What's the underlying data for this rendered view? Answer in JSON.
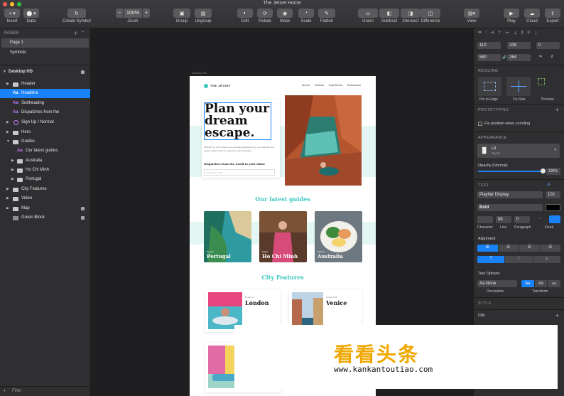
{
  "window": {
    "title": "The Jetset Home"
  },
  "toolbar": {
    "insert": "Insert",
    "data": "Data",
    "create_symbol": "Create Symbol",
    "zoom_value": "100%",
    "zoom": "Zoom",
    "group": "Group",
    "ungroup": "Ungroup",
    "edit": "Edit",
    "rotate": "Rotate",
    "mask": "Mask",
    "scale": "Scale",
    "flatten": "Flatten",
    "union": "Union",
    "subtract": "Subtract",
    "intersect": "Intersect",
    "difference": "Difference",
    "view": "View",
    "play": "Play",
    "cloud": "Cloud",
    "export": "Export"
  },
  "pages": {
    "header": "PAGES",
    "items": [
      "Page 1",
      "Symbols"
    ]
  },
  "layers": {
    "artboard": "Desktop HD",
    "items": [
      "Header",
      "Headline",
      "Subheading",
      "Dispatches from the",
      "Sign Up / Normal",
      "Hero",
      "Guides",
      "Our latest guides",
      "Australia",
      "Ho Chi Minh",
      "Portugal",
      "City Features",
      "Video",
      "Map",
      "Green Block"
    ],
    "filter": "Filter"
  },
  "canvas": {
    "artboard_label": "Desktop HD"
  },
  "artboard": {
    "brand": "THE JETSET",
    "nav": [
      "Brands",
      "Reviews",
      "Experiences",
      "Restaurants"
    ],
    "headline": "Plan your dream escape.",
    "body": "Whether it's a city break or an overseas sightseeing trip, the JetSetters are always ready to help you plan the perfect getaway.",
    "dispatch": "Dispatches from the world to your inbox",
    "email_placeholder": "Enter your email",
    "guides_title": "Our latest guides",
    "guides": [
      {
        "kicker": "Discover",
        "name": "Portugal"
      },
      {
        "kicker": "Explore",
        "name": "Ho Chi Minh"
      },
      {
        "kicker": "Discover",
        "name": "Australia"
      }
    ],
    "features_title": "City Features",
    "features": [
      {
        "kicker": "Weekend in",
        "name": "London"
      },
      {
        "kicker": "A Taste of Italy",
        "name": "Venice"
      }
    ]
  },
  "inspector": {
    "x": "110",
    "y": "208",
    "rotation": "0",
    "w": "580",
    "h": "264",
    "resizing": "RESIZING",
    "pin_to_edge": "Pin to Edge",
    "fix_size": "Fix Size",
    "preview": "Preview",
    "prototyping": "PROTOTYPING",
    "fix_position": "Fix position when scrolling",
    "appearance": "APPEARANCE",
    "style_name": "H1",
    "style_sub": "Styles",
    "opacity_label": "Opacity (Normal)",
    "opacity_value": "100%",
    "opacity": 1.0,
    "text": "TEXT",
    "font": "Playfair Display",
    "font_size": "102",
    "weight": "Bold",
    "line": "88",
    "paragraph": "0",
    "character_label": "Character",
    "line_label": "Line",
    "paragraph_label": "Paragraph",
    "fixed_label": "Fixed",
    "alignment": "Alignment",
    "text_options": "Text Options",
    "decoration_value": "Aa None",
    "decoration_label": "Decoration",
    "transform_label": "Transform",
    "transform_options": [
      "Aa",
      "AA",
      "aa"
    ],
    "style": "STYLE",
    "fills": "Fills"
  },
  "watermark": {
    "cn": "看看头条",
    "url": "www.kankantoutiao.com"
  },
  "colors": {
    "accent": "#1a82f7",
    "teal": "#3bc7bf",
    "watermark": "#f0a800"
  }
}
